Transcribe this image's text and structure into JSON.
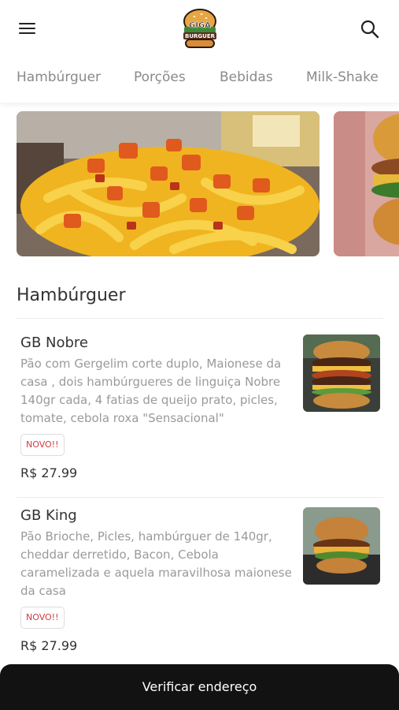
{
  "header": {
    "logo": {
      "line1": "GIGA",
      "line2": "BURGUER"
    }
  },
  "tabs": [
    "Hambúrguer",
    "Porções",
    "Bebidas",
    "Milk-Shake"
  ],
  "section": {
    "title": "Hambúrguer"
  },
  "products": [
    {
      "name": "GB Nobre",
      "description_lines": [
        "Pão com Gergelim corte duplo, Maionese da",
        "casa , dois hambúrgueres de linguiça Nobre",
        "140gr cada, 4 fatias de queijo prato, picles,",
        "tomate, cebola roxa \"Sensacional\""
      ],
      "badge": "NOVO!!",
      "price": "R$ 27.99"
    },
    {
      "name": "GB King",
      "description_lines": [
        "Pão Brioche, Picles, hambúrguer de 140gr,",
        "cheddar derretido, Bacon, Cebola",
        "caramelizada e aquela maravilhosa maionese",
        "da casa"
      ],
      "badge": "NOVO!!",
      "price": "R$ 27.99"
    }
  ],
  "bottom_bar": {
    "label": "Verificar endereço"
  },
  "colors": {
    "badge_text": "#d23b3b",
    "bottom_bar": "#121212"
  }
}
